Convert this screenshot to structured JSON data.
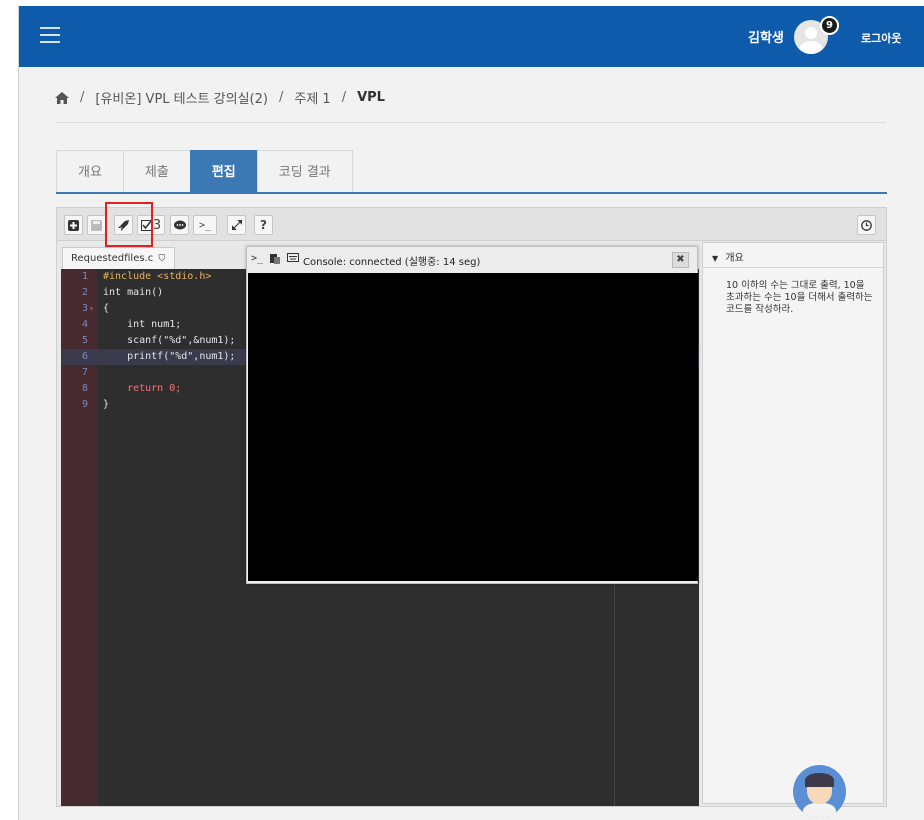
{
  "header": {
    "user_name": "김학생",
    "notification_count": "9",
    "logout_label": "로그아웃"
  },
  "breadcrumb": {
    "items": [
      "[유비온] VPL 테스트 강의실(2)",
      "주제 1",
      "VPL"
    ]
  },
  "tabs": [
    {
      "label": "개요"
    },
    {
      "label": "제출"
    },
    {
      "label": "편집"
    },
    {
      "label": "코딩 결과"
    }
  ],
  "toolbar": {
    "evaluate_count": "3",
    "help_label": "?"
  },
  "editor": {
    "file_name": "Requestedfiles.c",
    "lines": [
      {
        "num": "1",
        "text": "#include <stdio.h>"
      },
      {
        "num": "2",
        "text": "int main()"
      },
      {
        "num": "3",
        "text": "{"
      },
      {
        "num": "4",
        "text": "    int num1;"
      },
      {
        "num": "5",
        "text": "    scanf(\"%d\",&num1);"
      },
      {
        "num": "6",
        "text": "    printf(\"%d\",num1);"
      },
      {
        "num": "7",
        "text": ""
      },
      {
        "num": "8",
        "text": "    return 0;"
      },
      {
        "num": "9",
        "text": "}"
      }
    ]
  },
  "console": {
    "title": "Console: connected (실행중: 14 seg)",
    "close_label": "✖"
  },
  "description_panel": {
    "heading": "개요",
    "text": "10 이하의 수는 그대로 출력, 10을 초과하는 수는 10을 더해서 출력하는 코드를 작성하라."
  },
  "colors": {
    "header_bg": "#0e5bab",
    "active_tab": "#3c78b3",
    "highlight_box": "#e32020",
    "code_bg": "#2e2e2e",
    "console_bg": "#000000"
  },
  "icons": {
    "menu": "hamburger-icon",
    "home": "home-icon",
    "new_file": "plus-icon",
    "save": "save-icon",
    "run": "rocket-icon",
    "evaluate": "checkbox-icon",
    "debug": "speech-bubble-icon",
    "console": "terminal-icon",
    "fullscreen": "expand-icon",
    "help": "question-icon",
    "timer": "clock-icon"
  }
}
